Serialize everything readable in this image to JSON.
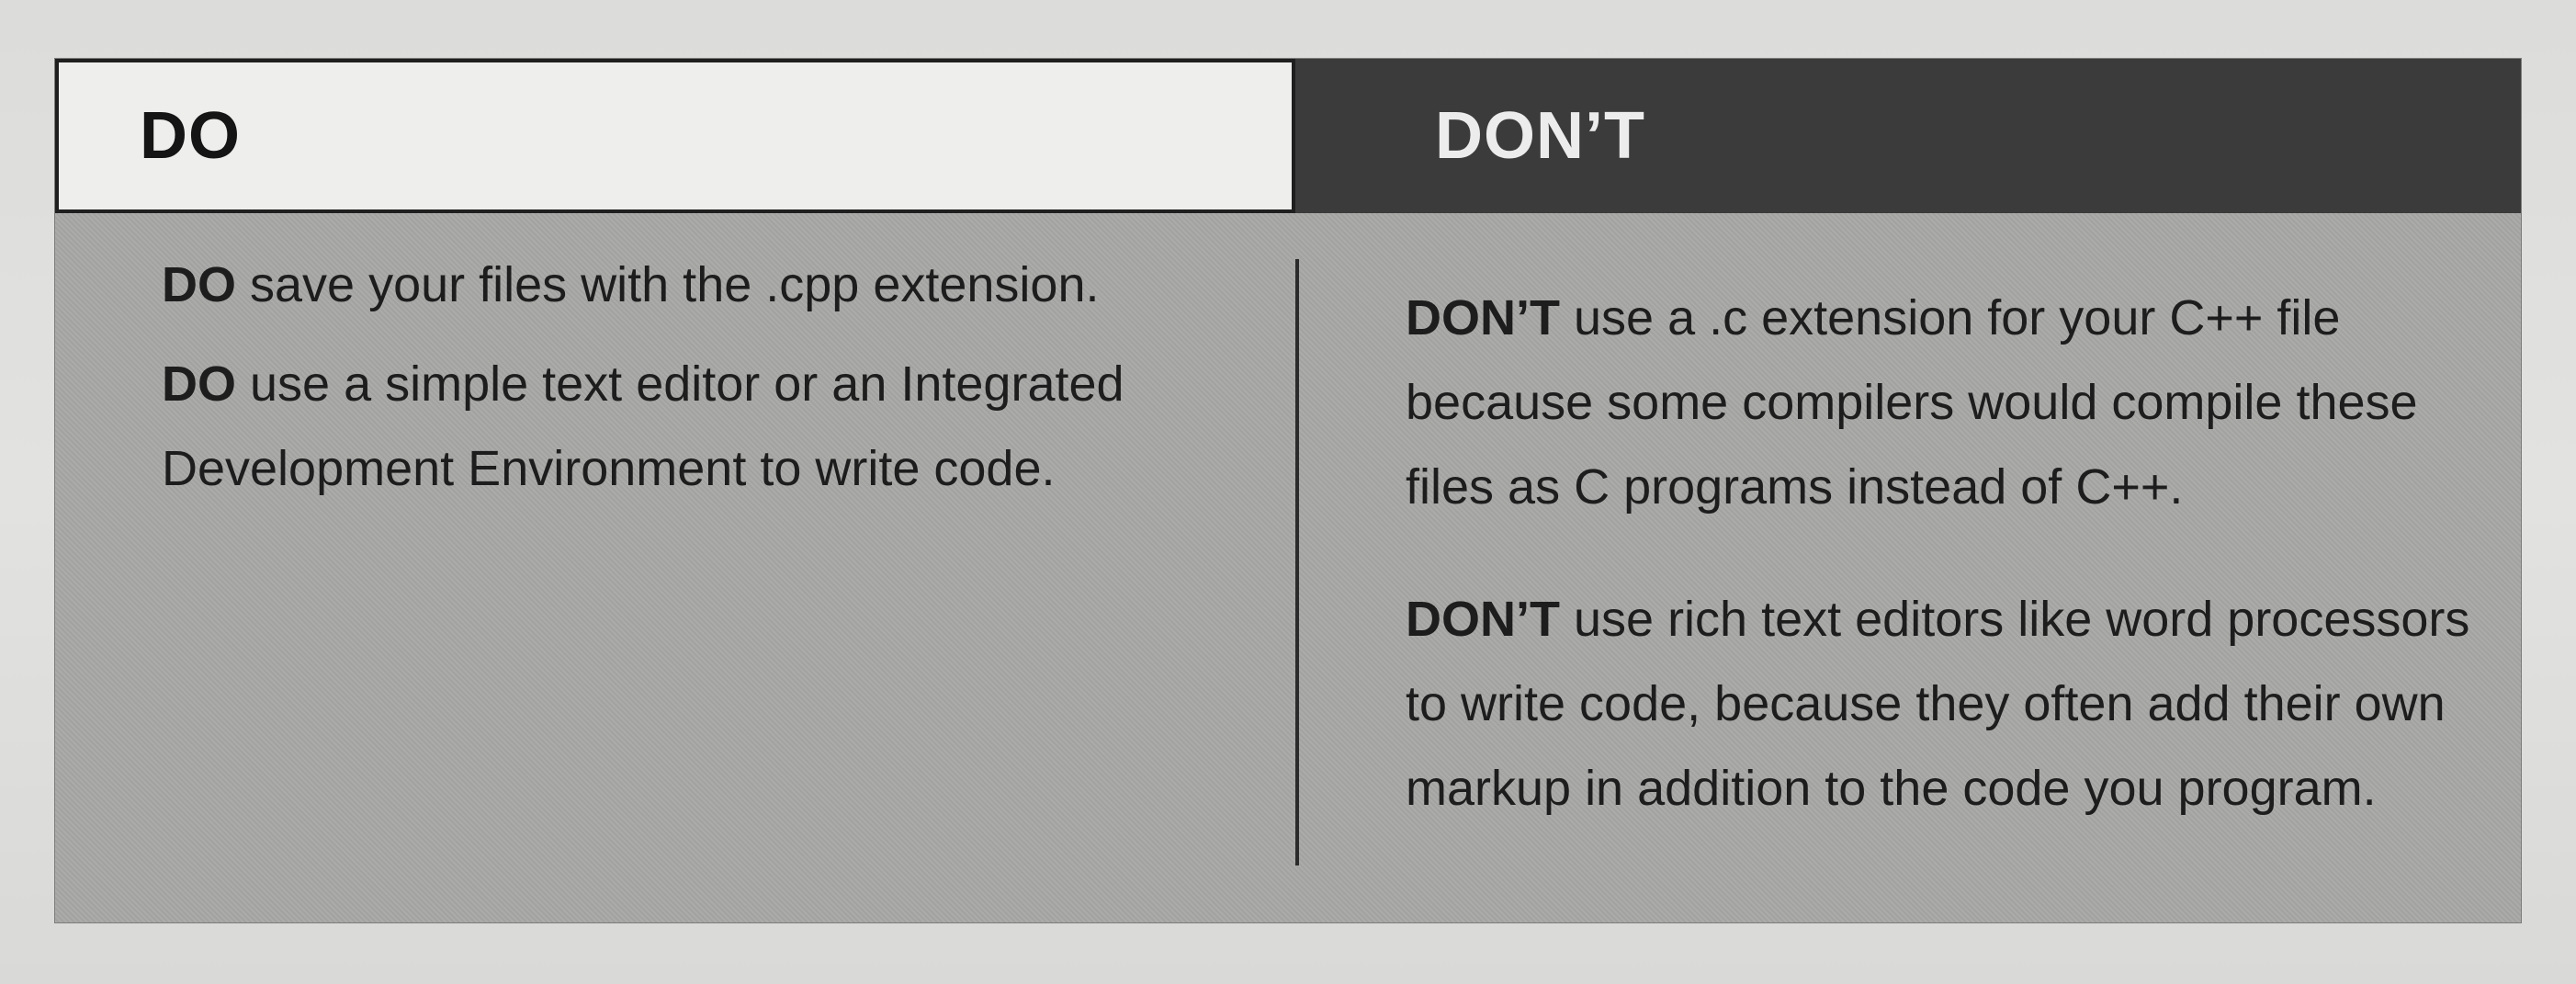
{
  "do_header": "DO",
  "dont_header": "DON’T",
  "do_items": [
    {
      "keyword": "DO",
      "text": " save your files with the .cpp extension."
    },
    {
      "keyword": "DO",
      "text": " use a simple text editor or an Integrated Development Environment to write code."
    }
  ],
  "dont_items": [
    {
      "keyword": "DON’T",
      "text": " use a .c extension for your C++ file because some compilers would compile these files as C programs instead of C++."
    },
    {
      "keyword": "DON’T",
      "text": " use rich text editors like word processors to write code, because they often add their own markup in addition to the code you program."
    }
  ],
  "colors": {
    "box_background": "#a7a8a5",
    "do_header_background": "#eeeeec",
    "dont_header_background": "#3b3b3b",
    "dont_header_text": "#ececec"
  }
}
